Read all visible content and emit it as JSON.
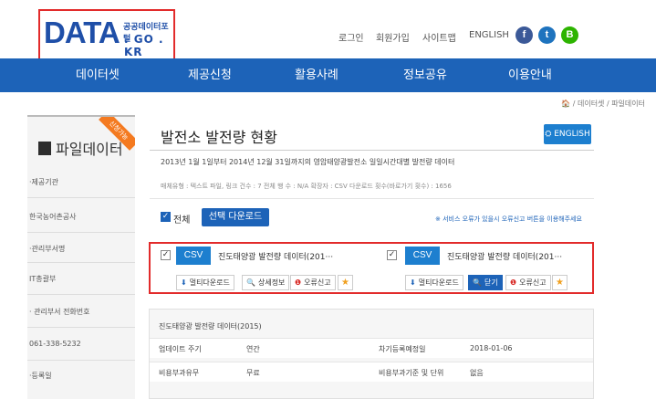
{
  "header": {
    "logo_text": "DATA",
    "logo_subtitle": "공공데이터포털",
    "logo_domain": ". GO . KR",
    "links": [
      "로그인",
      "회원가입",
      "사이트맵",
      "ENGLISH"
    ],
    "sns": [
      {
        "name": "facebook",
        "glyph": "f",
        "color": "#3b5998"
      },
      {
        "name": "twitter",
        "glyph": "t",
        "color": "#1e73be"
      },
      {
        "name": "blog",
        "glyph": "B",
        "color": "#2db400"
      }
    ]
  },
  "nav": [
    "데이터셋",
    "제공신청",
    "활용사례",
    "정보공유",
    "이용안내"
  ],
  "breadcrumb": "🏠 / 데이터셋 / 파일데이터",
  "sidebar": {
    "title": "파일데이터",
    "ribbon": "신청가능",
    "rows": [
      "·제공기관",
      "한국농어촌공사",
      "·관리부서명",
      "IT총괄부",
      "· 관리부서 전화번호",
      "061-338-5232",
      "·등록일"
    ]
  },
  "content": {
    "title": "발전소 발전량 현황",
    "english_button": "ENGLISH",
    "description": "2013년 1월 1일부터 2014년 12월 31일까지의 영암태양광발전소 일일시간대별 발전량 데이터",
    "meta": "매체유형 : 텍스트    파일, 링크 건수 : 7    전체 행 수 : N/A    확장자 : CSV    다운로드 횟수(바로가기 횟수) : 1656",
    "select_all": "전체",
    "select_download": "선택 다운로드",
    "notice": "※ 서비스 오류가 있을시 오류신고 버튼을 이용해주세요"
  },
  "files": [
    {
      "badge": "CSV",
      "name": "진도태양광 발전량 데이터(201···",
      "buttons": [
        "멀티다운로드",
        "상세정보",
        "오류신고"
      ]
    },
    {
      "badge": "CSV",
      "name": "진도태양광 발전량 데이터(201···",
      "buttons": [
        "멀티다운로드",
        "닫기",
        "오류신고"
      ]
    }
  ],
  "detail": {
    "title": "진도태양광 발전량 데이터(2015)",
    "rows": [
      {
        "label1": "업데이트 주기",
        "value1": "연간",
        "label2": "차기등록예정일",
        "value2": "2018-01-06"
      },
      {
        "label1": "비용부과유무",
        "value1": "무료",
        "label2": "비용부과기준 및 단위",
        "value2": "없음"
      }
    ]
  }
}
